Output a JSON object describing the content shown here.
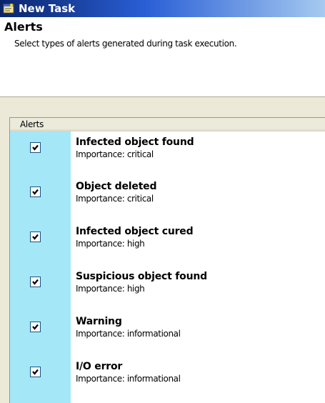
{
  "window": {
    "title": "New Task"
  },
  "header": {
    "title": "Alerts",
    "description": "Select types of alerts generated during task execution."
  },
  "list": {
    "column_header": "Alerts",
    "items": [
      {
        "title": "Infected object found",
        "importance": "Importance: critical",
        "checked": true
      },
      {
        "title": "Object deleted",
        "importance": "Importance: critical",
        "checked": true
      },
      {
        "title": "Infected object cured",
        "importance": "Importance: high",
        "checked": true
      },
      {
        "title": "Suspicious object found",
        "importance": "Importance: high",
        "checked": true
      },
      {
        "title": "Warning",
        "importance": "Importance: informational",
        "checked": true
      },
      {
        "title": "I/O error",
        "importance": "Importance: informational",
        "checked": true
      }
    ]
  },
  "colors": {
    "title_bar": "#0a246a",
    "check_column": "#a4e8f8",
    "dialog_background": "#ece9d8"
  },
  "icons": {
    "window": "task-window-icon",
    "checkbox": "checkmark-icon"
  }
}
